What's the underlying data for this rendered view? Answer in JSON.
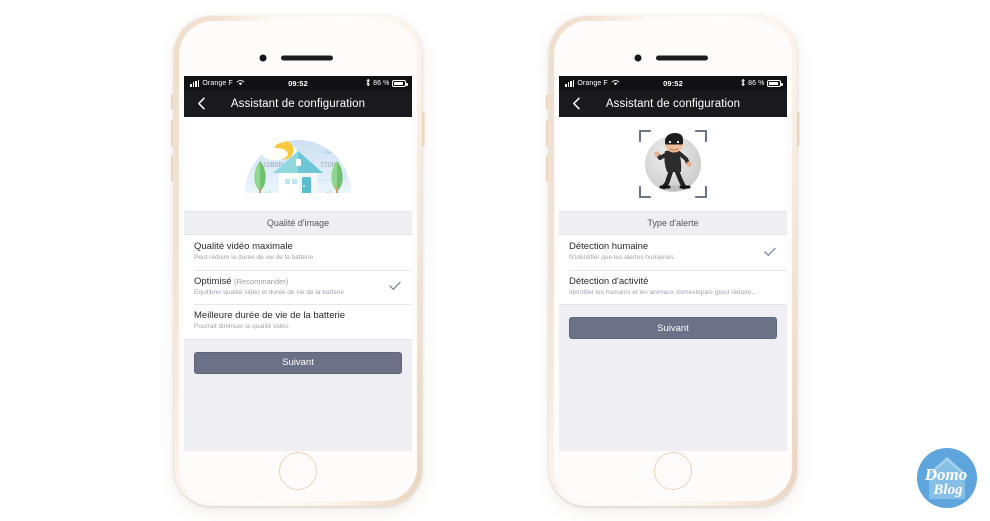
{
  "page": {
    "background": "#ffffff",
    "accent_button": "#6b7186",
    "accent_check": "#7b85a3",
    "phone_frame": "#f0ddcb"
  },
  "watermark": {
    "name": "domoblog-logo",
    "line1": "Domo",
    "line2": "Blog",
    "color": "#5ea5dd"
  },
  "phones": [
    {
      "id": "left",
      "statusbar": {
        "carrier": "Orange F",
        "time": "09:52",
        "battery_pct": "86 %",
        "icons": [
          "signal-bars-icon",
          "wifi-icon",
          "bluetooth-icon",
          "battery-icon"
        ]
      },
      "navbar": {
        "back_icon": "chevron-left-icon",
        "title": "Assistant de configuration"
      },
      "hero": {
        "illustration": "house-video-quality-illustration",
        "labels": [
          "1080P",
          "720P"
        ]
      },
      "section_header": "Qualité d'image",
      "rows": [
        {
          "title": "Qualité vidéo maximale",
          "title_suffix": "",
          "desc": "Peut réduire la durée de vie de la batterie",
          "selected": false
        },
        {
          "title": "Optimisé",
          "title_suffix": "(Recommander)",
          "desc": "Équilibrer qualité vidéo et durée de vie de la batterie",
          "selected": true
        },
        {
          "title": "Meilleure durée de vie de la batterie",
          "title_suffix": "",
          "desc": "Pourrait diminuer la qualité vidéo",
          "selected": false
        }
      ],
      "next_button": "Suivant"
    },
    {
      "id": "right",
      "statusbar": {
        "carrier": "Orange F",
        "time": "09:52",
        "battery_pct": "86 %",
        "icons": [
          "signal-bars-icon",
          "wifi-icon",
          "bluetooth-icon",
          "battery-icon"
        ]
      },
      "navbar": {
        "back_icon": "chevron-left-icon",
        "title": "Assistant de configuration"
      },
      "hero": {
        "illustration": "burglar-detection-illustration",
        "labels": []
      },
      "section_header": "Type d'alerte",
      "rows": [
        {
          "title": "Détection humaine",
          "title_suffix": "",
          "desc": "N'identifier que les alertes humaines",
          "selected": true
        },
        {
          "title": "Détection d'activité",
          "title_suffix": "",
          "desc": "Identifier les humains et les animaux domestiques (peut réduire...",
          "selected": false
        }
      ],
      "next_button": "Suivant"
    }
  ]
}
